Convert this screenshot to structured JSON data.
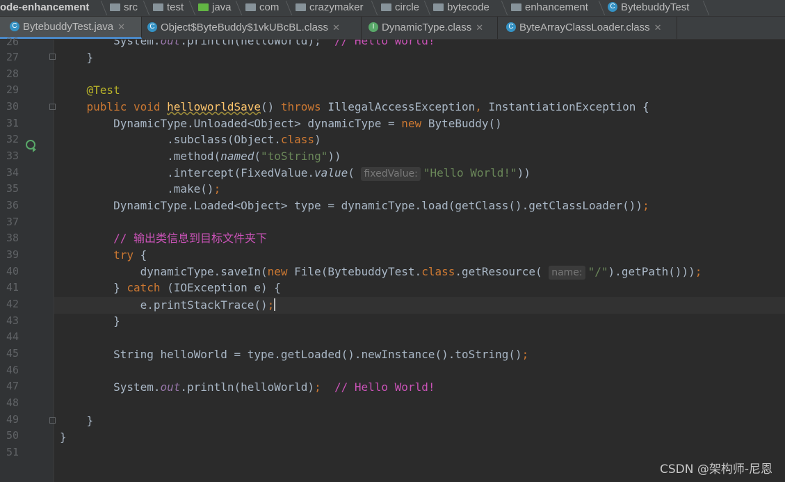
{
  "breadcrumb": [
    {
      "label": "ode-enhancement",
      "icon": "none",
      "bold": true
    },
    {
      "label": "src",
      "icon": "folder-icon"
    },
    {
      "label": "test",
      "icon": "folder-icon"
    },
    {
      "label": "java",
      "icon": "folder-green-icon"
    },
    {
      "label": "com",
      "icon": "folder-icon"
    },
    {
      "label": "crazymaker",
      "icon": "folder-icon"
    },
    {
      "label": "circle",
      "icon": "folder-icon"
    },
    {
      "label": "bytecode",
      "icon": "folder-icon"
    },
    {
      "label": "enhancement",
      "icon": "folder-icon"
    },
    {
      "label": "BytebuddyTest",
      "icon": "class-icon"
    }
  ],
  "tabs": [
    {
      "label": "BytebuddyTest.java",
      "icon": "C",
      "color": "#3592c4",
      "active": true
    },
    {
      "label": "Object$ByteBuddy$1vkUBcBL.class",
      "icon": "C",
      "color": "#3592c4",
      "active": false
    },
    {
      "label": "DynamicType.class",
      "icon": "I",
      "color": "#59a869",
      "active": false
    },
    {
      "label": "ByteArrayClassLoader.class",
      "icon": "C",
      "color": "#3592c4",
      "active": false
    }
  ],
  "colors": {
    "accent": "#4a88c7",
    "background": "#2b2b2b",
    "keyword": "#cc7832",
    "string": "#6a8759",
    "comment": "#cb53b8"
  },
  "editor": {
    "line_numbers": [
      "26",
      "27",
      "28",
      "29",
      "30",
      "31",
      "32",
      "33",
      "34",
      "35",
      "36",
      "37",
      "38",
      "39",
      "40",
      "41",
      "42",
      "43",
      "44",
      "45",
      "46",
      "47",
      "48",
      "49",
      "50",
      "51"
    ],
    "hint_fixed_value": "fixedValue:",
    "hint_name": "name:",
    "comment_chinese": "// 输出类信息到目标文件夹下",
    "comment_hello": "// Hello World!",
    "string_to_string": "\"toString\"",
    "string_hello": "\"Hello World!\"",
    "string_slash": "\"/\"",
    "method_name": "helloworldSave"
  },
  "watermark": "CSDN @架构师-尼恩"
}
